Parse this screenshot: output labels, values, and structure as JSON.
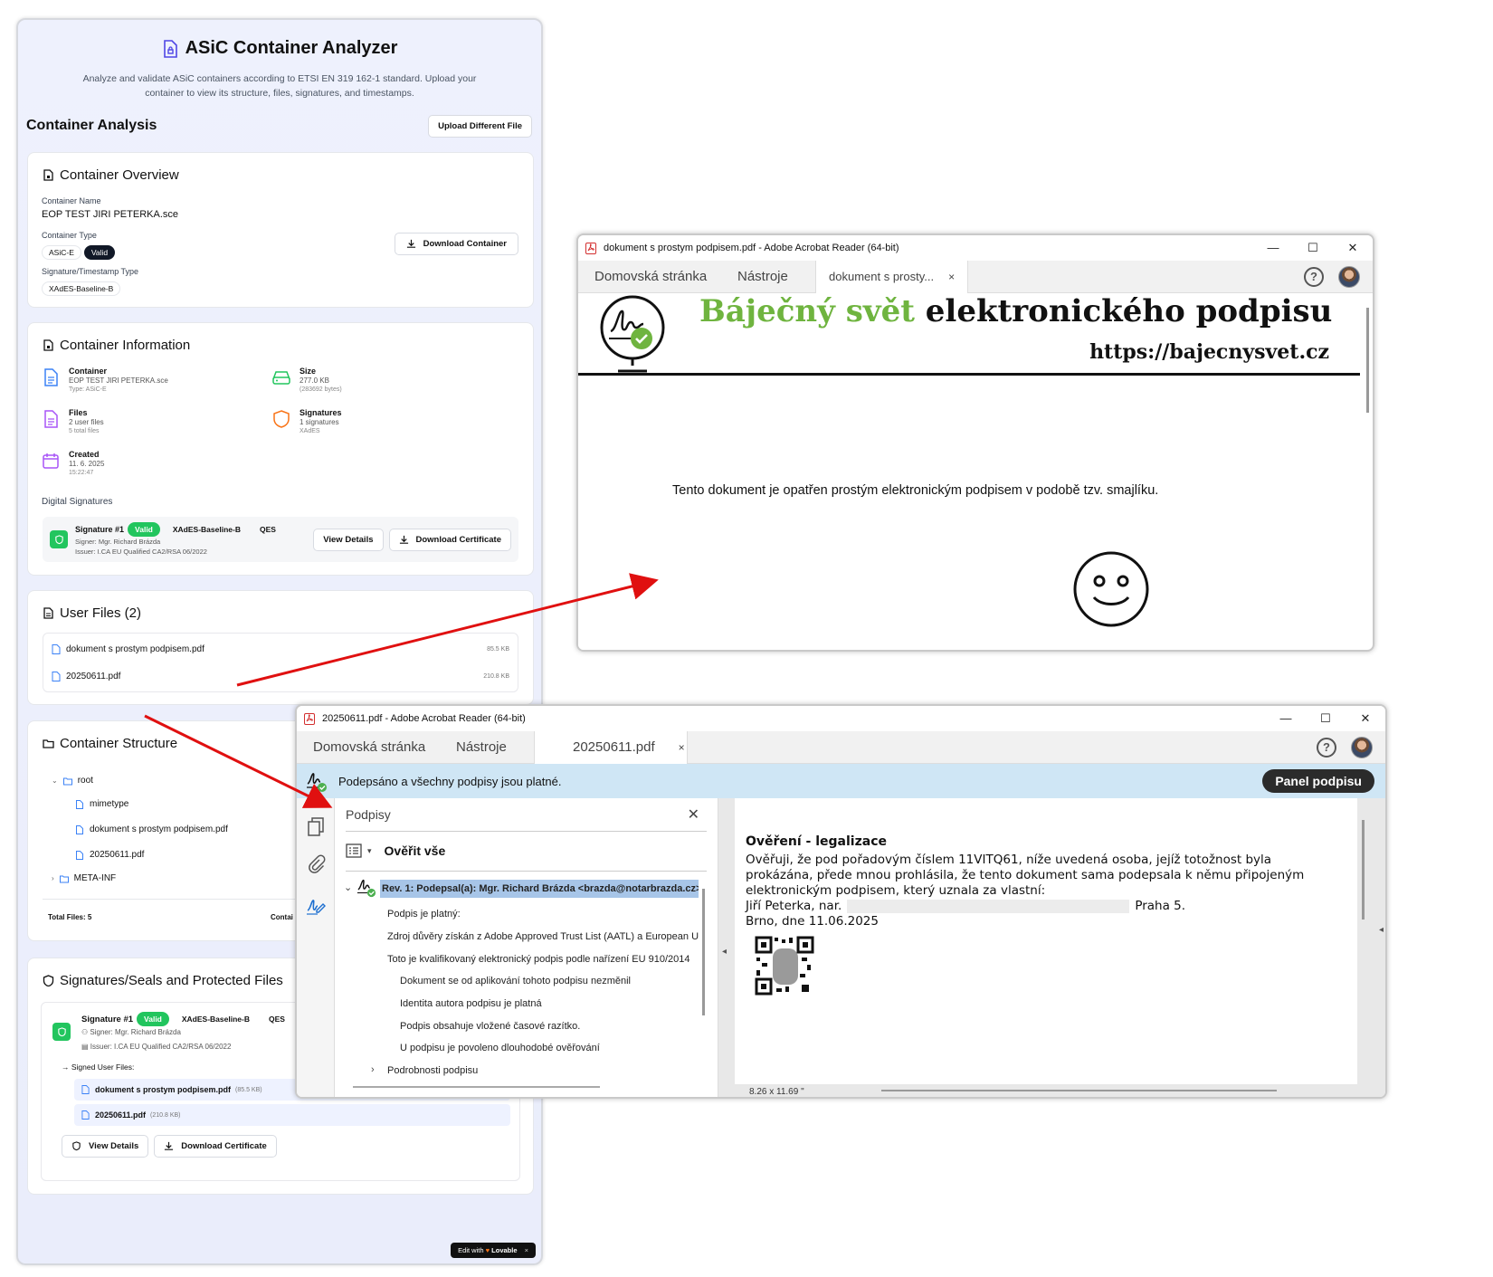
{
  "app": {
    "title": "ASiC Container Analyzer",
    "description": "Analyze and validate ASiC containers according to ETSI EN 319 162-1 standard. Upload your container to view its structure, files, signatures, and timestamps.",
    "analysis_title": "Container Analysis",
    "upload_button": "Upload Different File",
    "overview": {
      "title": "Container Overview",
      "name_label": "Container Name",
      "name_value": "EOP TEST JIRI PETERKA.sce",
      "type_label": "Container Type",
      "type_badge": "ASiC-E",
      "valid_badge": "Valid",
      "sig_type_label": "Signature/Timestamp Type",
      "sig_type_badge": "XAdES-Baseline-B",
      "download_button": "Download Container"
    },
    "info": {
      "title": "Container Information",
      "container_title": "Container",
      "container_name": "EOP TEST JIRI PETERKA.sce",
      "container_type": "Type: ASiC-E",
      "size_title": "Size",
      "size_value": "277.0 KB",
      "size_bytes": "(283692 bytes)",
      "files_title": "Files",
      "files_user": "2 user files",
      "files_total": "5 total files",
      "signatures_title": "Signatures",
      "signatures_count": "1 signatures",
      "signatures_format": "XAdES",
      "created_title": "Created",
      "created_date": "11. 6. 2025",
      "created_time": "15:22:47",
      "digital_sigs_label": "Digital Signatures",
      "sig_name": "Signature #1",
      "sig_valid": "Valid",
      "sig_level": "XAdES-Baseline-B",
      "sig_qes": "QES",
      "signer": "Signer: Mgr. Richard Brázda",
      "issuer": "Issuer: I.CA EU Qualified CA2/RSA 06/2022",
      "view_details": "View Details",
      "download_cert": "Download Certificate"
    },
    "user_files": {
      "title": "User Files (2)",
      "files": [
        {
          "name": "dokument s prostym podpisem.pdf",
          "size": "85.5 KB"
        },
        {
          "name": "20250611.pdf",
          "size": "210.8 KB"
        }
      ]
    },
    "structure": {
      "title": "Container Structure",
      "root": "root",
      "items": [
        "mimetype",
        "dokument s prostym podpisem.pdf",
        "20250611.pdf"
      ],
      "meta": "META-INF",
      "total_files": "Total Files: 5",
      "truncated": "Contai"
    },
    "seals": {
      "title": "Signatures/Seals and Protected Files",
      "sig_name": "Signature #1",
      "sig_valid": "Valid",
      "sig_level": "XAdES-Baseline-B",
      "sig_qes": "QES",
      "signer": "Signer: Mgr. Richard Brázda",
      "issuer": "Issuer: I.CA EU Qualified CA2/RSA 06/2022",
      "signed_label": "Signed User Files:",
      "files": [
        {
          "name": "dokument s prostym podpisem.pdf",
          "size": "(85.5 KB)"
        },
        {
          "name": "20250611.pdf",
          "size": "(210.8 KB)"
        }
      ],
      "view_details": "View Details",
      "download_cert": "Download Certificate"
    },
    "lovable_prefix": "Edit with",
    "lovable_brand": "Lovable",
    "lovable_close": "×"
  },
  "window1": {
    "title": "dokument s prostym podpisem.pdf - Adobe Acrobat Reader (64-bit)",
    "tab_home": "Domovská stránka",
    "tab_tools": "Nástroje",
    "tab_doc": "dokument s prosty...",
    "tab_close": "×",
    "help": "?",
    "ctl_min": "—",
    "ctl_max": "☐",
    "ctl_close": "✕",
    "heading_green": "Báječný svět",
    "heading_black": "elektronického podpisu",
    "url": "https://bajecnysvet.cz",
    "body_text": "Tento dokument je opatřen prostým elektronickým podpisem v podobě tzv. smajlíku."
  },
  "window2": {
    "title": "20250611.pdf - Adobe Acrobat Reader (64-bit)",
    "tab_home": "Domovská stránka",
    "tab_tools": "Nástroje",
    "tab_doc": "20250611.pdf",
    "tab_close": "×",
    "help": "?",
    "ctl_min": "—",
    "ctl_max": "☐",
    "ctl_close": "✕",
    "sigbar_text": "Podepsáno a všechny podpisy jsou platné.",
    "panel_button": "Panel podpisu",
    "panel_title": "Podpisy",
    "panel_close": "✕",
    "verify_all": "Ověřit vše",
    "rev": "Rev. 1: Podepsal(a): Mgr. Richard Brázda <brazda@notarbrazda.cz>",
    "details": [
      "Podpis je platný:",
      "Zdroj důvěry získán z Adobe Approved Trust List (AATL) a European U",
      "Toto je kvalifikovaný elektronický podpis podle nařízení EU 910/2014"
    ],
    "subdetails": [
      "Dokument se od aplikování tohoto podpisu nezměnil",
      "Identita autora podpisu je platná",
      "Podpis obsahuje vložené časové razítko.",
      "U podpisu je povoleno dlouhodobé ověřování"
    ],
    "more_details": "Podrobnosti podpisu",
    "doc_heading": "Ověření - legalizace",
    "doc_lines": [
      "Ověřuji, že pod pořadovým číslem 11VITQ61, níže uvedená osoba, jejíž totožnost byla",
      "prokázána, přede mnou prohlásila, že tento dokument sama podepsala k němu připojeným",
      "elektronickým podpisem, který uznala za vlastní:"
    ],
    "person": "Jiří Peterka, nar.",
    "city": "Praha 5.",
    "place_date": "Brno, dne 11.06.2025",
    "page_size": "8.26 x 11.69 \""
  }
}
